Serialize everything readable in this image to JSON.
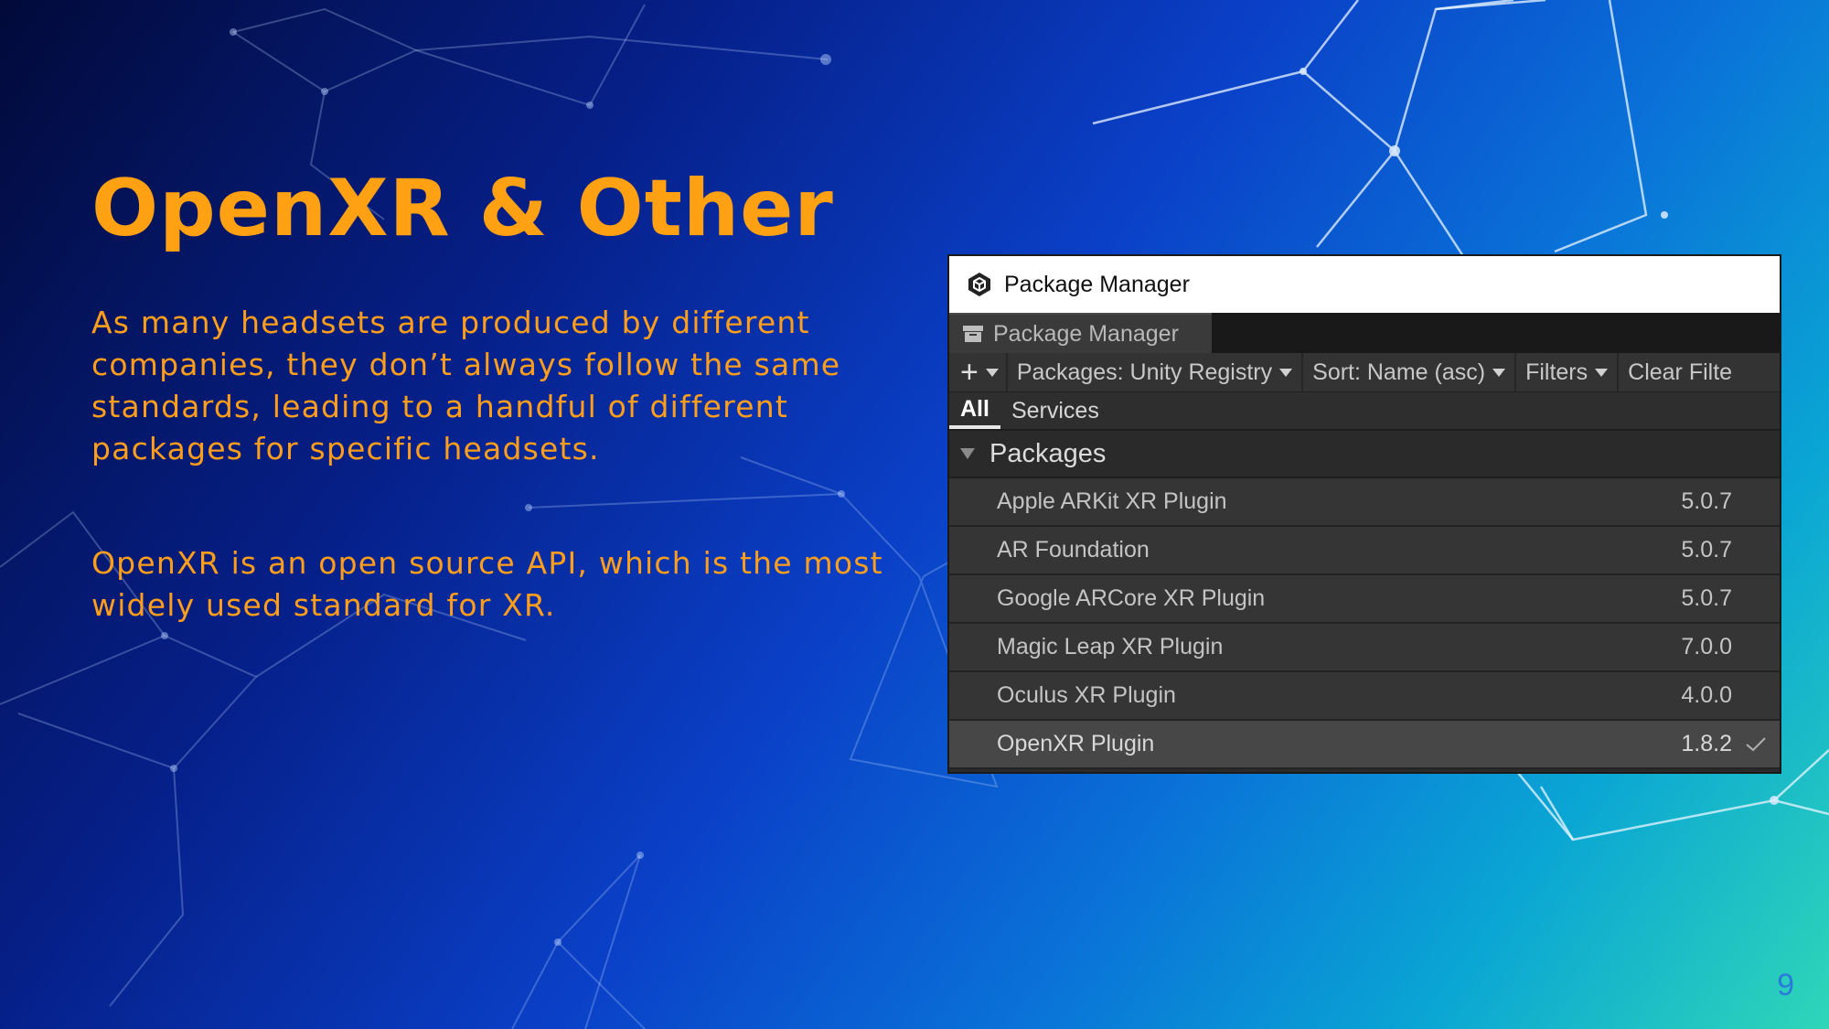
{
  "slide": {
    "title": "OpenXR & Other",
    "paragraph1": "As many headsets are produced by different companies, they don’t always follow the same standards, leading to a handful of different packages for specific headsets.",
    "paragraph2": "OpenXR is an open source API, which is the most widely used standard for XR.",
    "page_number": "9"
  },
  "colors": {
    "accent": "#ffa112",
    "page_number": "#2a7bd8"
  },
  "package_manager": {
    "window_title": "Package Manager",
    "tab_label": "Package Manager",
    "toolbar": {
      "add_icon": "plus-icon",
      "packages_dropdown": "Packages: Unity Registry",
      "sort_dropdown": "Sort: Name (asc)",
      "filters_dropdown": "Filters",
      "clear_filters": "Clear Filte"
    },
    "subtabs": [
      "All",
      "Services"
    ],
    "group_label": "Packages",
    "packages": [
      {
        "name": "Apple ARKit XR Plugin",
        "version": "5.0.7",
        "installed": false
      },
      {
        "name": "AR Foundation",
        "version": "5.0.7",
        "installed": false
      },
      {
        "name": "Google ARCore XR Plugin",
        "version": "5.0.7",
        "installed": false
      },
      {
        "name": "Magic Leap XR Plugin",
        "version": "7.0.0",
        "installed": false
      },
      {
        "name": "Oculus XR Plugin",
        "version": "4.0.0",
        "installed": false
      },
      {
        "name": "OpenXR Plugin",
        "version": "1.8.2",
        "installed": true
      }
    ]
  }
}
